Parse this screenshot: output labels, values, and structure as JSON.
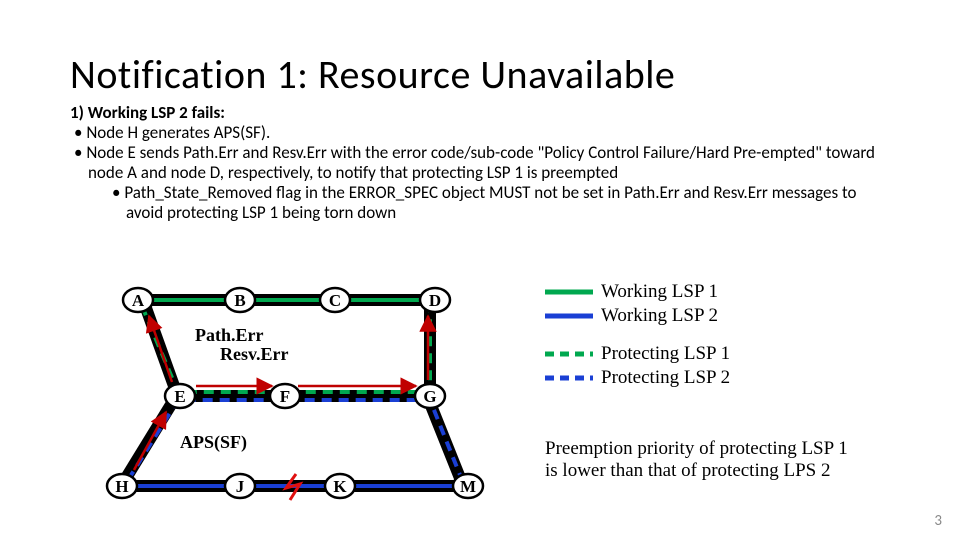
{
  "title": "Notification 1: Resource Unavailable",
  "bullets": {
    "b1_prefix": "1)  ",
    "b1": "Working LSP 2 fails:",
    "b2_prefix": "• ",
    "b2": "Node H generates APS(SF).",
    "b3_prefix": "• ",
    "b3": "Node E sends Path.Err and Resv.Err with the error code/sub-code \"Policy Control Failure/Hard Pre-empted\" toward node A and node D, respectively, to notify that protecting LSP 1 is preempted",
    "b4_prefix": "• ",
    "b4": "Path_State_Removed flag in the ERROR_SPEC object MUST not be set in Path.Err and Resv.Err messages to avoid protecting LSP 1 being torn down"
  },
  "nodes": {
    "A": "A",
    "B": "B",
    "C": "C",
    "D": "D",
    "E": "E",
    "F": "F",
    "G": "G",
    "H": "H",
    "J": "J",
    "K": "K",
    "M": "M"
  },
  "annot": {
    "path_err": "Path.Err",
    "resv_err": "Resv.Err",
    "aps_sf": "APS(SF)"
  },
  "legend": {
    "w1": "Working LSP 1",
    "w2": "Working LSP 2",
    "p1": "Protecting LSP 1",
    "p2": "Protecting LSP 2"
  },
  "note": "Preemption priority of protecting LSP 1 is lower than that of protecting LPS 2",
  "slide_number": "3",
  "chart_data": {
    "type": "diagram",
    "nodes": [
      {
        "id": "A",
        "row": 0,
        "col": 0
      },
      {
        "id": "B",
        "row": 0,
        "col": 1
      },
      {
        "id": "C",
        "row": 0,
        "col": 2
      },
      {
        "id": "D",
        "row": 0,
        "col": 3
      },
      {
        "id": "E",
        "row": 1,
        "col": 0.5
      },
      {
        "id": "F",
        "row": 1,
        "col": 1.8
      },
      {
        "id": "G",
        "row": 1,
        "col": 3
      },
      {
        "id": "H",
        "row": 2,
        "col": 0
      },
      {
        "id": "J",
        "row": 2,
        "col": 1.4
      },
      {
        "id": "K",
        "row": 2,
        "col": 2.3
      },
      {
        "id": "M",
        "row": 2,
        "col": 3.3
      }
    ],
    "paths": {
      "working_lsp_1": {
        "color": "#00a84f",
        "style": "solid",
        "route": [
          "A",
          "B",
          "C",
          "D"
        ]
      },
      "working_lsp_2": {
        "color": "#1a3fd4",
        "style": "solid",
        "route": [
          "H",
          "J",
          "K",
          "M"
        ]
      },
      "protecting_lsp_1": {
        "color": "#00a84f",
        "style": "dashed",
        "route": [
          "A",
          "E",
          "F",
          "G",
          "D"
        ]
      },
      "protecting_lsp_2": {
        "color": "#1a3fd4",
        "style": "dashed",
        "route": [
          "H",
          "E",
          "F",
          "G",
          "M"
        ]
      }
    },
    "failure_link": [
      "J",
      "K"
    ],
    "messages": [
      {
        "label": "Path.Err",
        "from": "E",
        "to": "A"
      },
      {
        "label": "Resv.Err",
        "from": "E",
        "to": "D",
        "via": [
          "F",
          "G"
        ]
      },
      {
        "label": "APS(SF)",
        "from": "H",
        "to": "E"
      }
    ]
  }
}
